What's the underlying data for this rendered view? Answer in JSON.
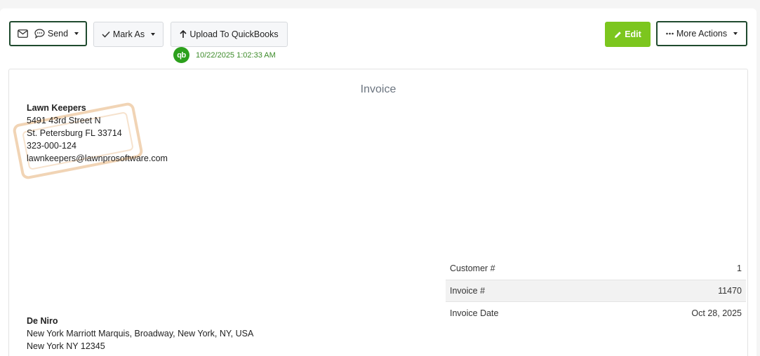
{
  "toolbar": {
    "send_label": "Send",
    "mark_as_label": "Mark As",
    "upload_label": "Upload To QuickBooks",
    "edit_label": "Edit",
    "more_actions_label": "More Actions"
  },
  "quickbooks": {
    "logo_text": "qb",
    "sync_timestamp": "10/22/2025 1:02:33 AM"
  },
  "invoice": {
    "title": "Invoice",
    "company": {
      "name": "Lawn Keepers",
      "street": "5491 43rd Street N",
      "city_line": "St. Petersburg FL 33714",
      "phone": "323-000-124",
      "email": "lawnkeepers@lawnprosoftware.com"
    },
    "meta": [
      {
        "label": "Customer #",
        "value": "1"
      },
      {
        "label": "Invoice #",
        "value": "11470"
      },
      {
        "label": "Invoice Date",
        "value": "Oct 28, 2025"
      }
    ],
    "customer": {
      "name": "De Niro",
      "address": "New York Marriott Marquis, Broadway, New York, NY, USA",
      "city_line": "New York NY 12345"
    }
  },
  "colors": {
    "accent_green": "#7cc61e",
    "outline_dark_green": "#1f4a2e",
    "quickbooks_green": "#2ca01c"
  },
  "icons": [
    "envelope-icon",
    "sms-icon",
    "check-icon",
    "arrow-up-icon",
    "pencil-icon",
    "ellipsis-icon",
    "chevron-down-icon"
  ]
}
